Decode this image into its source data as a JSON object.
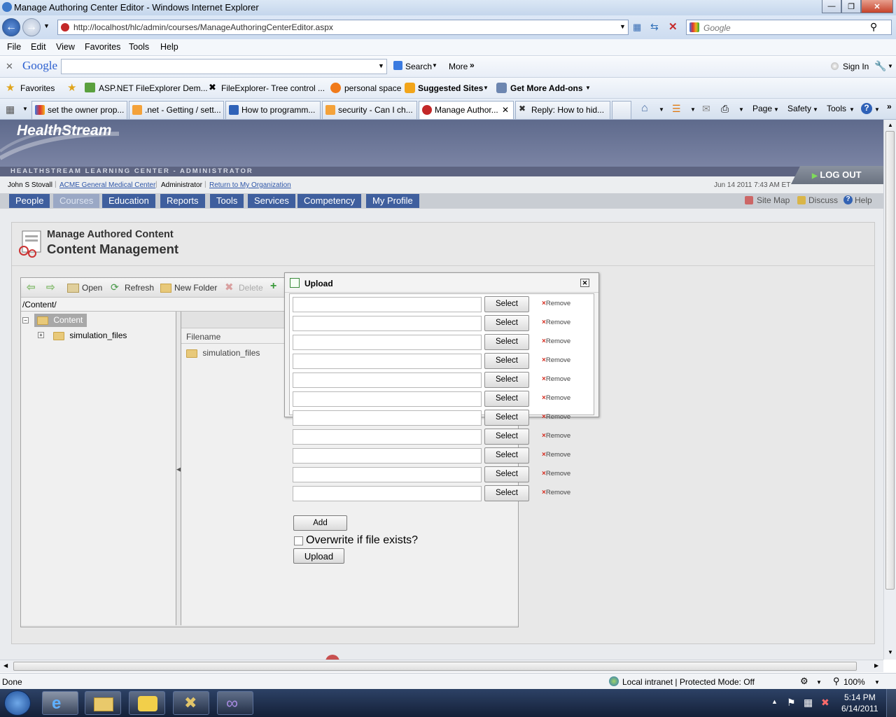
{
  "window": {
    "title": "Manage Authoring Center Editor - Windows Internet Explorer"
  },
  "addressbar": {
    "url": "http://localhost/hlc/admin/courses/ManageAuthoringCenterEditor.aspx",
    "search_placeholder": "Google"
  },
  "menu": [
    "File",
    "Edit",
    "View",
    "Favorites",
    "Tools",
    "Help"
  ],
  "googlebar": {
    "logo": "Google",
    "search_label": "Search",
    "more_label": "More",
    "signin_label": "Sign In"
  },
  "favorites": {
    "favorites_label": "Favorites",
    "items": [
      "ASP.NET FileExplorer Dem...",
      "FileExplorer- Tree control ...",
      "personal space",
      "Suggested Sites",
      "Get More Add-ons"
    ]
  },
  "tabs": [
    {
      "label": "set the owner prop...",
      "active": false
    },
    {
      "label": ".net - Getting / sett...",
      "active": false
    },
    {
      "label": "How to programm...",
      "active": false
    },
    {
      "label": "security - Can I ch...",
      "active": false
    },
    {
      "label": "Manage Author...",
      "active": true
    },
    {
      "label": "Reply: How to hid...",
      "active": false
    }
  ],
  "commandbar": {
    "page": "Page",
    "safety": "Safety",
    "tools": "Tools"
  },
  "app": {
    "logo": "HealthStream",
    "band": "HEALTHSTREAM LEARNING CENTER - ADMINISTRATOR",
    "user": "John S Stovall",
    "org": "ACME General Medical Center",
    "role": "Administrator",
    "return_link": "Return to My Organization",
    "datetime": "Jun 14 2011 7:43 AM ET",
    "logout": "LOG OUT",
    "nav": [
      {
        "label": "People",
        "selected": false
      },
      {
        "label": "Courses",
        "selected": true
      },
      {
        "label": "Education",
        "selected": false
      },
      {
        "label": "Reports",
        "selected": false
      },
      {
        "label": "Tools",
        "selected": false
      },
      {
        "label": "Services",
        "selected": false
      },
      {
        "label": "Competency",
        "selected": false
      },
      {
        "label": "My Profile",
        "selected": false
      }
    ],
    "sitemap": "Site Map",
    "discuss": "Discuss",
    "help": "Help",
    "page_subtitle": "Manage Authored Content",
    "page_title": "Content Management"
  },
  "explorer": {
    "toolbar": {
      "open": "Open",
      "refresh": "Refresh",
      "new_folder": "New Folder",
      "delete": "Delete"
    },
    "path": "/Content/",
    "tree_root": "Content",
    "tree_child": "simulation_files",
    "col_filename": "Filename",
    "files": [
      "simulation_files"
    ]
  },
  "upload": {
    "title": "Upload",
    "select_label": "Select",
    "remove_label": "Remove",
    "row_count": 11,
    "add_label": "Add",
    "overwrite_label": "Overwrite if file exists?",
    "upload_label": "Upload"
  },
  "statusbar": {
    "left": "Done",
    "zone": "Local intranet | Protected Mode: Off",
    "zoom": "100%"
  },
  "taskbar": {
    "time": "5:14 PM",
    "date": "6/14/2011"
  }
}
